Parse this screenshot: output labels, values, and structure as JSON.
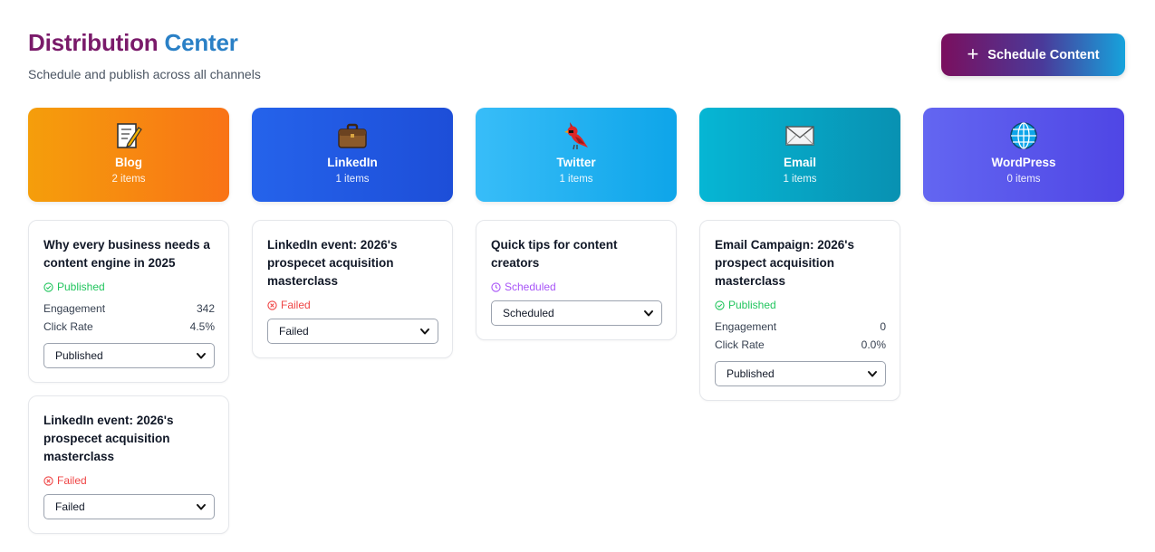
{
  "header": {
    "title_part1": "Distribution",
    "title_part2": "Center",
    "subtitle": "Schedule and publish across all channels"
  },
  "actions": {
    "schedule_label": "Schedule Content",
    "schedule_icon": "plus-icon"
  },
  "channels": [
    {
      "name": "Blog",
      "count": "2 items",
      "icon": "memo-icon",
      "gradient": [
        "#f59e0b",
        "#f97316"
      ],
      "cards": [
        {
          "title": "Why every business needs a content engine in 2025",
          "status": "Published",
          "status_type": "published",
          "metrics": [
            {
              "label": "Engagement",
              "value": "342"
            },
            {
              "label": "Click Rate",
              "value": "4.5%"
            }
          ],
          "select_value": "Published"
        },
        {
          "title": "LinkedIn event: 2026's prospecet acquisition masterclass",
          "status": "Failed",
          "status_type": "failed",
          "metrics": [],
          "select_value": "Failed"
        }
      ]
    },
    {
      "name": "LinkedIn",
      "count": "1 items",
      "icon": "briefcase-icon",
      "gradient": [
        "#2563eb",
        "#1d4ed8"
      ],
      "cards": [
        {
          "title": "LinkedIn event: 2026's prospecet acquisition masterclass",
          "status": "Failed",
          "status_type": "failed",
          "metrics": [],
          "select_value": "Failed"
        }
      ]
    },
    {
      "name": "Twitter",
      "count": "1 items",
      "icon": "bird-icon",
      "gradient": [
        "#38bdf8",
        "#0ea5e9"
      ],
      "cards": [
        {
          "title": "Quick tips for content creators",
          "status": "Scheduled",
          "status_type": "scheduled",
          "metrics": [],
          "select_value": "Scheduled"
        }
      ]
    },
    {
      "name": "Email",
      "count": "1 items",
      "icon": "envelope-icon",
      "gradient": [
        "#06b6d4",
        "#0891b2"
      ],
      "cards": [
        {
          "title": "Email Campaign: 2026's prospect acquisition masterclass",
          "status": "Published",
          "status_type": "published",
          "metrics": [
            {
              "label": "Engagement",
              "value": "0"
            },
            {
              "label": "Click Rate",
              "value": "0.0%"
            }
          ],
          "select_value": "Published"
        }
      ]
    },
    {
      "name": "WordPress",
      "count": "0 items",
      "icon": "globe-icon",
      "gradient": [
        "#6366f1",
        "#4f46e5"
      ],
      "cards": []
    }
  ]
}
